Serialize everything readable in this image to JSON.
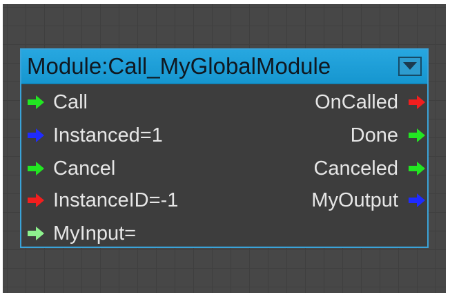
{
  "node": {
    "title": "Module:Call_MyGlobalModule",
    "collapse_icon": "chevron-down-icon",
    "inputs": [
      {
        "label": "Call",
        "color": "#22e622"
      },
      {
        "label": "Instanced=1",
        "color": "#1f2bff"
      },
      {
        "label": "Cancel",
        "color": "#22e622"
      },
      {
        "label": "InstanceID=-1",
        "color": "#f21e1e"
      },
      {
        "label": "MyInput=",
        "color": "#8ef28e"
      }
    ],
    "outputs": [
      {
        "label": "OnCalled",
        "color": "#f21e1e"
      },
      {
        "label": "Done",
        "color": "#22e622"
      },
      {
        "label": "Canceled",
        "color": "#22e622"
      },
      {
        "label": "MyOutput",
        "color": "#1f2bff"
      }
    ]
  },
  "colors": {
    "canvas": "#474747",
    "node_body": "#3d3d3d",
    "header": "#1e9fd8",
    "border": "#3aa3d9"
  }
}
